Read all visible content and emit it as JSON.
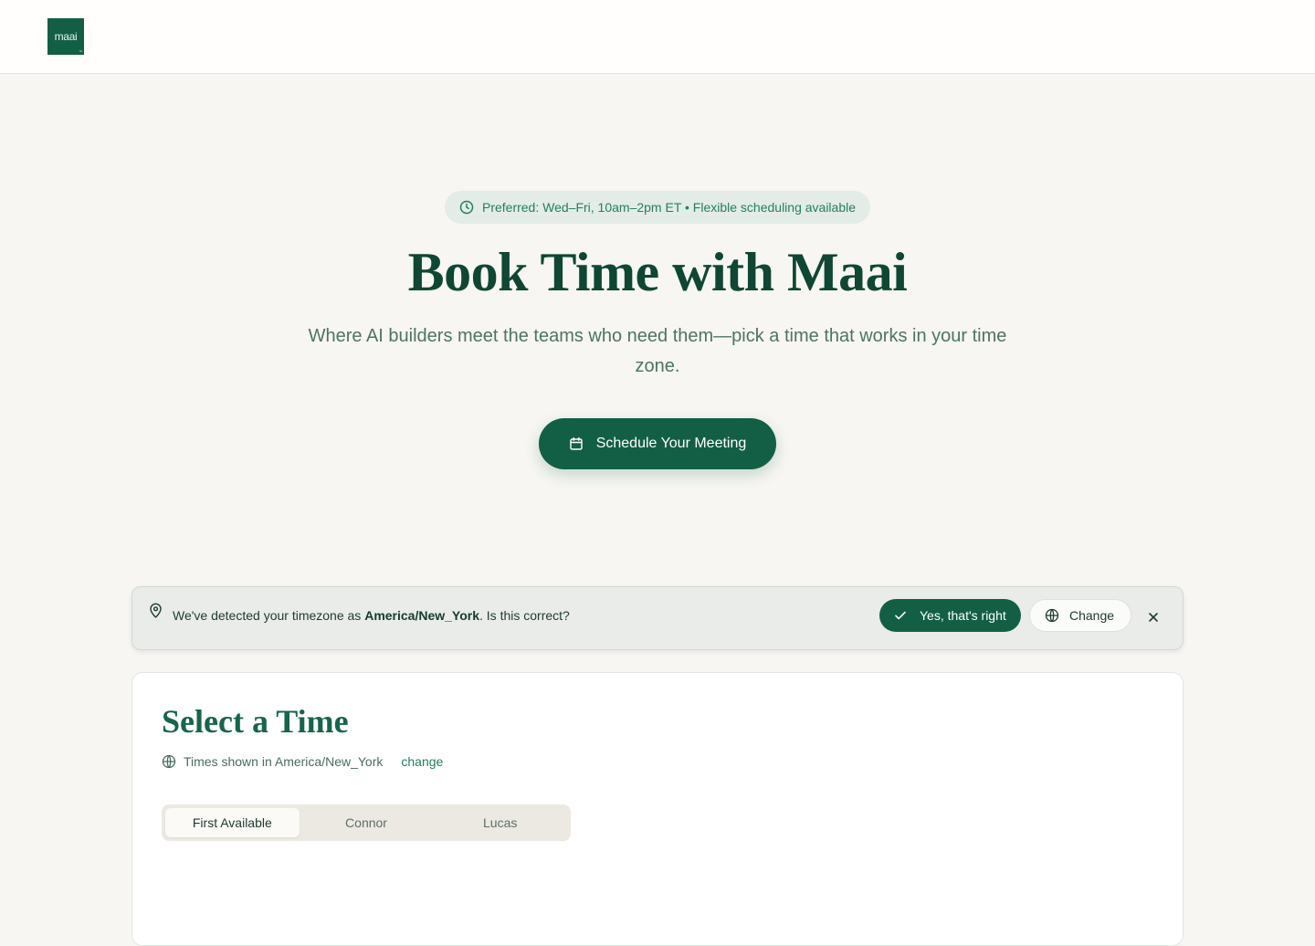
{
  "header": {
    "logo_text": "maai",
    "logo_mark": "™"
  },
  "hero": {
    "availability_pill": "Preferred: Wed–Fri, 10am–2pm ET • Flexible scheduling available",
    "title": "Book Time with Maai",
    "subtitle": "Where AI builders meet the teams who need them—pick a time that works in your time zone.",
    "cta_label": "Schedule Your Meeting"
  },
  "timezone_banner": {
    "text_before": "We've detected your timezone as ",
    "timezone": "America/New_York",
    "text_after": ". Is this correct?",
    "confirm_label": "Yes, that's right",
    "change_label": "Change"
  },
  "picker": {
    "title": "Select a Time",
    "times_shown_label": "Times shown in America/New_York",
    "change_link": "change",
    "tabs": [
      {
        "label": "First Available",
        "active": true
      },
      {
        "label": "Connor",
        "active": false
      },
      {
        "label": "Lucas",
        "active": false
      }
    ]
  },
  "colors": {
    "brand": "#135f45",
    "title": "#0f4634",
    "accent_text": "#23805c",
    "background": "#f7f6f2"
  },
  "icons": {
    "pill": "clock-icon",
    "cta": "calendar-icon",
    "banner": "map-pin-icon",
    "confirm": "check-icon",
    "change": "globe-icon",
    "dismiss": "close-icon"
  }
}
